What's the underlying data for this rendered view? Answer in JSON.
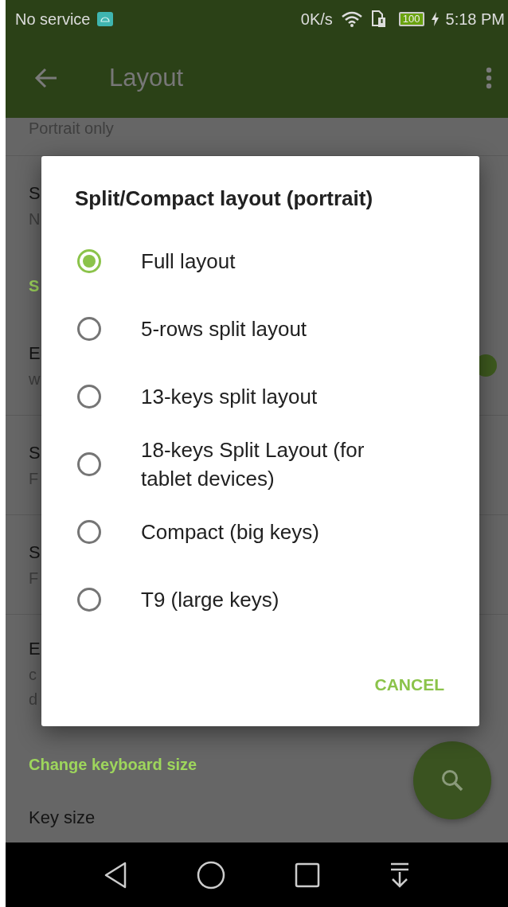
{
  "status_bar": {
    "carrier": "No service",
    "speed": "0K/s",
    "battery": "100",
    "time": "5:18 PM"
  },
  "toolbar": {
    "title": "Layout"
  },
  "settings": [
    {
      "kind": "summary",
      "summary": "Portrait only"
    },
    {
      "kind": "pref",
      "title": "S",
      "summary": [
        "N"
      ]
    },
    {
      "kind": "header",
      "title": "S"
    },
    {
      "kind": "switch",
      "title": "E",
      "summary": [
        "w"
      ],
      "on": true
    },
    {
      "kind": "pref",
      "title": "S",
      "summary": [
        "F"
      ]
    },
    {
      "kind": "pref",
      "title": "S",
      "summary": [
        "F"
      ]
    },
    {
      "kind": "pref",
      "title": "E",
      "summary": [
        "c",
        "d"
      ]
    },
    {
      "kind": "header",
      "title": "Change keyboard size"
    },
    {
      "kind": "pref",
      "title": "Key size"
    }
  ],
  "dialog": {
    "title": "Split/Compact layout (portrait)",
    "options": [
      {
        "label": "Full layout",
        "selected": true
      },
      {
        "label": "5-rows split layout",
        "selected": false
      },
      {
        "label": "13-keys split layout",
        "selected": false
      },
      {
        "label": "18-keys Split Layout (for tablet devices)",
        "selected": false
      },
      {
        "label": "Compact (big keys)",
        "selected": false
      },
      {
        "label": "T9 (large keys)",
        "selected": false
      }
    ],
    "buttons": [
      "CANCEL"
    ]
  }
}
